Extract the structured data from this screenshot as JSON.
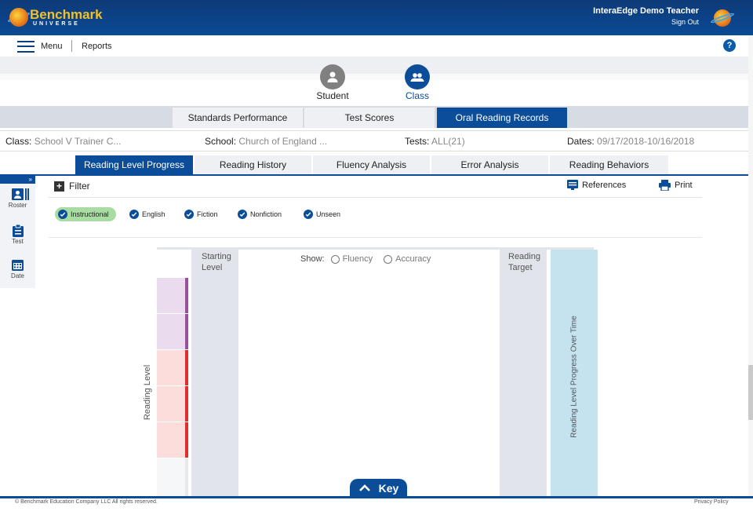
{
  "header": {
    "logo_line1": "Benchmark",
    "logo_line2": "UNIVERSE",
    "user_name": "InteraEdge Demo Teacher",
    "sign_out": "Sign Out",
    "brand_color": "#0b3e80"
  },
  "menubar": {
    "menu_label": "Menu",
    "reports_label": "Reports",
    "help_label": "?"
  },
  "view_switch": {
    "student_label": "Student",
    "class_label": "Class",
    "selected": "Class"
  },
  "report_tabs": [
    "Standards Performance",
    "Test Scores",
    "Oral Reading Records"
  ],
  "report_tab_active": "Oral Reading Records",
  "info": {
    "class_label": "Class:",
    "class_value": "School V Trainer C...",
    "school_label": "School:",
    "school_value": "Church of England ...",
    "tests_label": "Tests:",
    "tests_value": "ALL(21)",
    "dates_label": "Dates:",
    "dates_value": "09/17/2018-10/16/2018"
  },
  "sub_tabs": [
    "Reading Level Progress",
    "Reading History",
    "Fluency Analysis",
    "Error Analysis",
    "Reading Behaviors"
  ],
  "sub_tab_active": "Reading Level Progress",
  "sidebar": {
    "toggle": "»",
    "items": [
      {
        "label": "Roster",
        "icon": "roster-icon"
      },
      {
        "label": "Test",
        "icon": "clipboard-icon"
      },
      {
        "label": "Date",
        "icon": "calendar-icon"
      }
    ]
  },
  "toolbar": {
    "filter_label": "Filter",
    "references_label": "References",
    "print_label": "Print"
  },
  "filter_chips": [
    {
      "label": "Instructional",
      "highlighted": true
    },
    {
      "label": "English",
      "highlighted": false
    },
    {
      "label": "Fiction",
      "highlighted": false
    },
    {
      "label": "Nonfiction",
      "highlighted": false
    },
    {
      "label": "Unseen",
      "highlighted": false
    }
  ],
  "chart": {
    "starting_level_label": "Starting Level",
    "reading_target_label": "Reading Target",
    "progress_label": "Reading Level Progress Over Time",
    "y_axis_label": "Reading Level",
    "show_label": "Show:",
    "show_options": [
      "Fluency",
      "Accuracy"
    ],
    "level_band_colors": [
      "#eadcee",
      "#eadcee",
      "#fddcdc",
      "#fddcdc",
      "#fddcdc",
      "#f6f7f9"
    ],
    "level_bar_colors": [
      "#9b4f9b",
      "#9b4f9b",
      "#e0302e",
      "#e0302e",
      "#e0302e",
      "#e6e8ec"
    ]
  },
  "key_label": "Key",
  "footer": {
    "copyright": "© Benchmark Education Company LLC All rights reserved.",
    "privacy": "Privacy Policy"
  }
}
